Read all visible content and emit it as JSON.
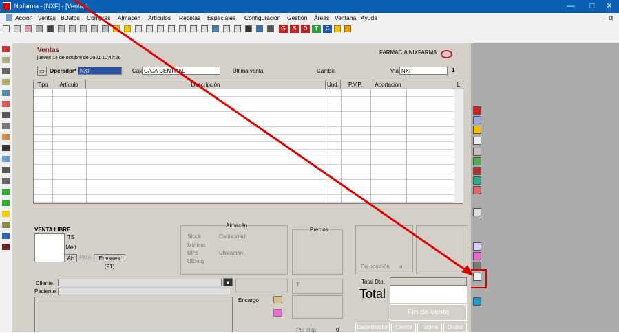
{
  "window": {
    "title": "Nixfarma - [NXF] - [Ventas]",
    "min": "—",
    "max": "□",
    "close": "✕",
    "child_min": "_",
    "child_restore": "⧉"
  },
  "menu": [
    "Acción",
    "Ventas",
    "BDatos",
    "Compras",
    "Almacén",
    "Artículos",
    "Recetas",
    "Especiales",
    "Configuración",
    "Gestión",
    "Áreas",
    "Ventana",
    "Ayuda"
  ],
  "quick": [
    "G",
    "S",
    "D",
    "T",
    "C"
  ],
  "header": {
    "title": "Ventas",
    "date": "jueves 14 de octubre de 2021 10:47:26",
    "pharmacy": "FARMACIA NIXFARMA"
  },
  "operator": {
    "label": "Operador*",
    "value": "NXF",
    "caja_label": "Caja",
    "caja_value": "CAJA CENTRAL",
    "last_sale": "Última venta",
    "cambio": "Cambio",
    "vta_label": "Vta",
    "vta_value": "NXF",
    "count": "1"
  },
  "grid": {
    "columns": [
      "Tipo",
      "Artículo",
      "Descripción",
      "Und.",
      "P.V.P.",
      "Aportación",
      "",
      "L"
    ]
  },
  "venta": {
    "title": "VENTA LIBRE",
    "ts": "TS",
    "med": "Méd",
    "ah": "AH",
    "pma": "PMA",
    "envases": "Envases (F1)"
  },
  "almacen": {
    "title": "Almacén",
    "stock": "Stock",
    "caducidad": "Caducidad",
    "minimo": "Mínimo",
    "ups": "UPS",
    "ubicacion": "Ubicación",
    "uencg": "UEncg"
  },
  "precios": {
    "title": "Precios",
    "deposito": "De posición",
    "a": "a"
  },
  "cliente": {
    "label": "Cliente",
    "paciente": "Paciente",
    "encargo": "Encargo",
    "t": "T.",
    "pte": "Pte disp.",
    "pte_value": "0"
  },
  "totals": {
    "dto": "Total Dto.",
    "total": "Total",
    "fin": "Fin de venta",
    "dispensador": "Dispensador",
    "cliente": "Cliente",
    "tarjeta": "Tarjeta",
    "divisa": "Divisa"
  },
  "colors": {
    "title": "#0a61b3",
    "highlight": "#e00000"
  }
}
